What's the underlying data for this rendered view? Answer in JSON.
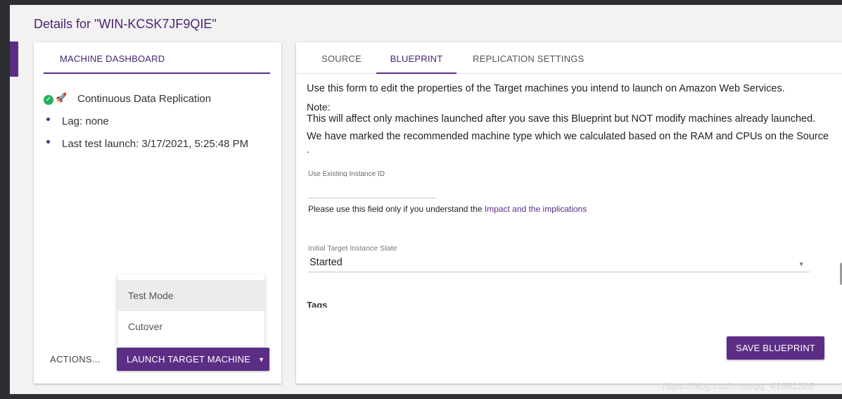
{
  "page": {
    "title": "Details for \"WIN-KCSK7JF9QIE\""
  },
  "left_panel": {
    "dashboard_tab": "MACHINE DASHBOARD",
    "status_items": [
      {
        "label": "Continuous Data Replication",
        "icons": [
          "check-circle-icon",
          "rocket-icon"
        ]
      },
      {
        "label": "Lag: none"
      },
      {
        "label": "Last test launch: 3/17/2021, 5:25:48 PM"
      }
    ],
    "dropdown": {
      "items": [
        {
          "label": "Test Mode",
          "active": true
        },
        {
          "label": "Cutover",
          "active": false
        }
      ]
    },
    "actions_label": "ACTIONS...",
    "launch_button": "LAUNCH TARGET MACHINE"
  },
  "right_panel": {
    "tabs": [
      {
        "label": "SOURCE",
        "active": false
      },
      {
        "label": "BLUEPRINT",
        "active": true
      },
      {
        "label": "REPLICATION SETTINGS",
        "active": false
      }
    ],
    "intro": "Use this form to edit the properties of the Target machines you intend to launch on Amazon Web Services.",
    "note_label": "Note:",
    "note_text": "This will affect only machines launched after you save this Blueprint but NOT modify machines already launched.",
    "recommend_text": "We have marked the recommended machine type which we calculated based on the RAM and CPUs on the Source",
    "recommend_tail": ".",
    "existing_instance": {
      "label": "Use Existing Instance ID",
      "value": "",
      "help_prefix": "Please use this field only if you understand the ",
      "help_link": "Impact and the implications"
    },
    "initial_state": {
      "label": "Initial Target Instance State",
      "value": "Started"
    },
    "tags_heading": "Tags",
    "save_button": "SAVE BLUEPRINT"
  },
  "watermark": "https://blog.csdn.net/qq_41861526",
  "colors": {
    "accent": "#5c2d85",
    "success": "#21b05c",
    "background": "#f2f2f2"
  }
}
